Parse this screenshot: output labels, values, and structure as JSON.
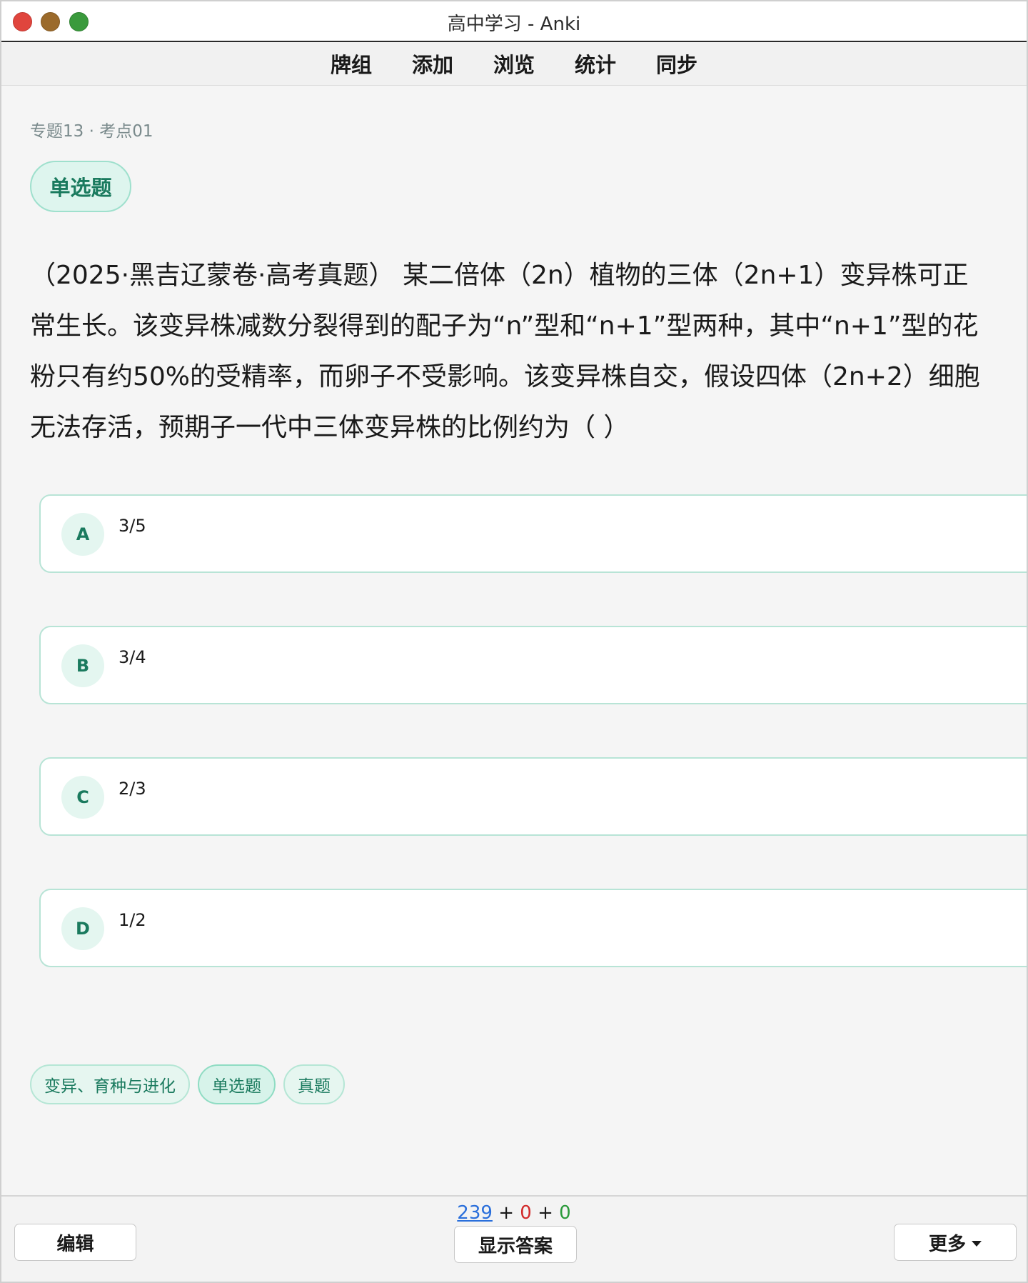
{
  "window": {
    "title": "高中学习 - Anki"
  },
  "toolbar": {
    "items": [
      "牌组",
      "添加",
      "浏览",
      "统计",
      "同步"
    ]
  },
  "card": {
    "breadcrumb": "专题13 · 考点01",
    "type_badge": "单选题",
    "question": "（2025·黑吉辽蒙卷·高考真题） 某二倍体（2n）植物的三体（2n+1）变异株可正常生长。该变异株减数分裂得到的配子为“n”型和“n+1”型两种，其中“n+1”型的花粉只有约50%的受精率，而卵子不受影响。该变异株自交，假设四体（2n+2）细胞无法存活，预期子一代中三体变异株的比例约为（ ）",
    "options": [
      {
        "letter": "A",
        "text": "3/5"
      },
      {
        "letter": "B",
        "text": "3/4"
      },
      {
        "letter": "C",
        "text": "2/3"
      },
      {
        "letter": "D",
        "text": "1/2"
      }
    ],
    "tags": [
      "变异、育种与进化",
      "单选题",
      "真题"
    ]
  },
  "bottom": {
    "counts": {
      "new": "239",
      "learn": "0",
      "review": "0"
    },
    "plus": "+",
    "edit_label": "编辑",
    "show_answer_label": "显示答案",
    "more_label": "更多"
  },
  "colors": {
    "accent": "#1a7a5e",
    "new_count": "#2a6fdb",
    "learn_count": "#d22a2a",
    "review_count": "#2a9a3a"
  }
}
